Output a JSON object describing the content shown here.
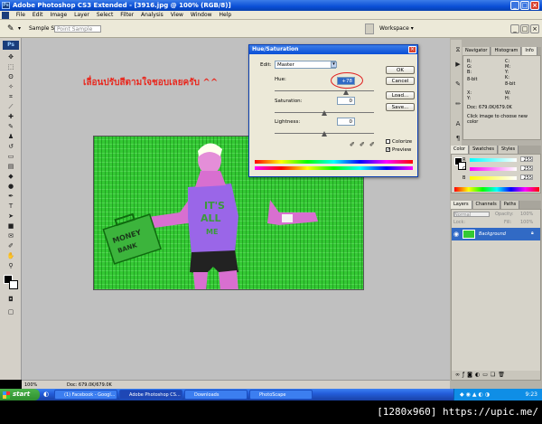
{
  "window": {
    "title": "Adobe Photoshop CS3 Extended - [3916.jpg @ 100% (RGB/8)]"
  },
  "menu": [
    "File",
    "Edit",
    "Image",
    "Layer",
    "Select",
    "Filter",
    "Analysis",
    "View",
    "Window",
    "Help"
  ],
  "options": {
    "sample_size_label": "Sample Size:",
    "sample_size_value": "Point Sample",
    "workspace_label": "Workspace ▾"
  },
  "annotation": {
    "thai_text": "เลื่อนปรับสีตามใจชอบเลยครับ ^^",
    "color": "#e8281e"
  },
  "dialog": {
    "title": "Hue/Saturation",
    "edit_label": "Edit:",
    "edit_value": "Master",
    "hue_label": "Hue:",
    "hue_value": "+78",
    "saturation_label": "Saturation:",
    "saturation_value": "0",
    "lightness_label": "Lightness:",
    "lightness_value": "0",
    "hue_fraction": 0.72,
    "saturation_fraction": 0.5,
    "lightness_fraction": 0.5,
    "ok": "OK",
    "cancel": "Cancel",
    "load": "Load...",
    "save": "Save...",
    "colorize": "Colorize",
    "preview": "Preview",
    "preview_checked": true,
    "colorize_checked": false
  },
  "panels": {
    "top_tabs": [
      "Navigator",
      "Histogram",
      "Info"
    ],
    "info": {
      "r": "R:",
      "g": "G:",
      "b": "B:",
      "c": "C:",
      "m": "M:",
      "y": "Y:",
      "k": "K:",
      "bit1": "8-bit",
      "bit2": "8-bit",
      "x": "X:",
      "y2": "Y:",
      "w": "W:",
      "h": "H:",
      "doc": "Doc: 679.0K/679.0K",
      "hint": "Click image to choose new color"
    },
    "color_tabs": [
      "Color",
      "Swatches",
      "Styles"
    ],
    "color": {
      "r": "R",
      "g": "G",
      "b": "B",
      "r_val": "255",
      "g_val": "255",
      "b_val": "255"
    },
    "layers_tabs": [
      "Layers",
      "Channels",
      "Paths"
    ],
    "layers": {
      "mode": "Normal",
      "opacity_label": "Opacity:",
      "opacity_value": "100%",
      "lock_label": "Lock:",
      "fill_label": "Fill:",
      "fill_value": "100%",
      "layer_name": "Background"
    }
  },
  "status": {
    "zoom": "100%",
    "doc": "Doc: 679.0K/679.0K"
  },
  "taskbar": {
    "start": "start",
    "tasks": [
      "(1) Facebook - Googl...",
      "Adobe Photoshop CS...",
      "Downloads",
      "PhotoScape"
    ],
    "clock": "9:23"
  },
  "watermark": "[1280x960] https://upic.me/"
}
